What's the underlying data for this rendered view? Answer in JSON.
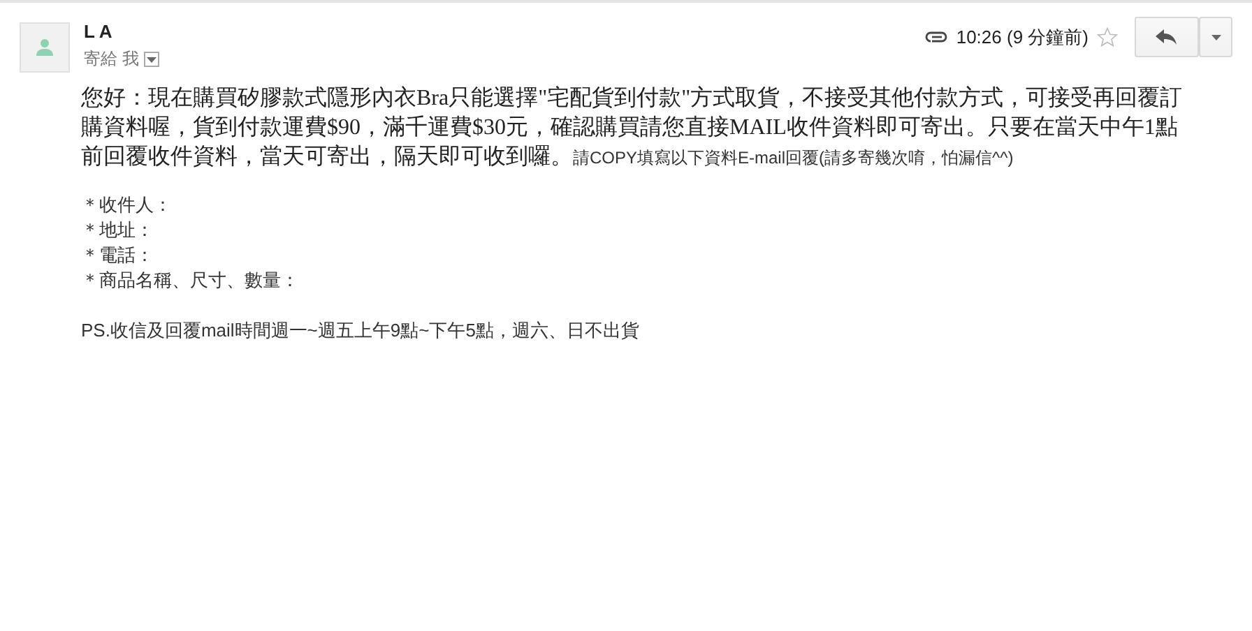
{
  "message": {
    "sender": "L A",
    "recipient_label": "寄給 我",
    "time": "10:26 (9 分鐘前)",
    "has_attachment": true,
    "starred": false
  },
  "body": {
    "lines": [
      "您好：現在購買矽膠款式隱形內衣Bra只能選擇\"宅配貨到付款\"方式取貨，不接受其他付款方式，可接受再回覆訂",
      "購資料喔，貨到付款運費$90，滿千運費$30元，確認購買請您直接MAIL收件資料即可寄出。只要在當天中午1點",
      "前回覆收件資料，當天可寄出，隔天即可收到囉。"
    ],
    "note": "請COPY填寫以下資料E-mail回覆(請多寄幾次唷，怕漏信^^)",
    "fields": [
      "＊收件人：",
      "＊地址：",
      "＊電話：",
      "＊商品名稱、尺寸、數量："
    ],
    "ps": "PS.收信及回覆mail時間週一~週五上午9點~下午5點，週六、日不出貨"
  }
}
